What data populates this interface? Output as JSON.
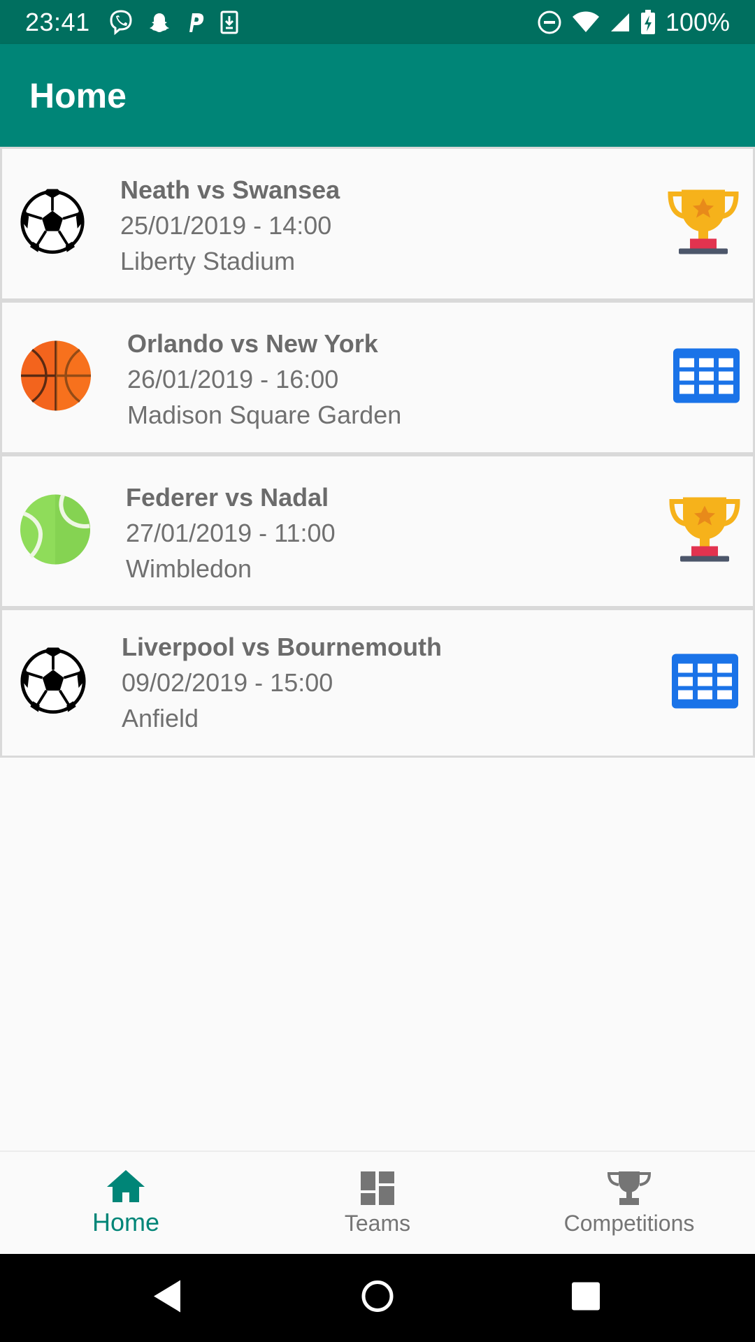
{
  "status_bar": {
    "time": "23:41",
    "battery_text": "100%",
    "left_icons": [
      "viber-icon",
      "snapchat-icon",
      "parking-icon",
      "download-icon"
    ],
    "right_icons": [
      "do-not-disturb-icon",
      "wifi-icon",
      "cell-signal-icon",
      "battery-charging-icon"
    ]
  },
  "app_bar": {
    "title": "Home"
  },
  "matches": [
    {
      "title": "Neath vs Swansea",
      "datetime": "25/01/2019 - 14:00",
      "venue": "Liberty Stadium",
      "sport_icon": "soccer-ball-icon",
      "action_icon": "trophy-icon"
    },
    {
      "title": "Orlando vs New York",
      "datetime": "26/01/2019 - 16:00",
      "venue": "Madison Square Garden",
      "sport_icon": "basketball-icon",
      "action_icon": "table-grid-icon"
    },
    {
      "title": "Federer vs Nadal",
      "datetime": "27/01/2019 - 11:00",
      "venue": "Wimbledon",
      "sport_icon": "tennis-ball-icon",
      "action_icon": "trophy-icon"
    },
    {
      "title": "Liverpool vs Bournemouth",
      "datetime": "09/02/2019 - 15:00",
      "venue": "Anfield",
      "sport_icon": "soccer-ball-icon",
      "action_icon": "table-grid-icon"
    }
  ],
  "bottom_nav": {
    "items": [
      {
        "label": "Home",
        "icon": "home-icon",
        "active": true
      },
      {
        "label": "Teams",
        "icon": "dashboard-icon",
        "active": false
      },
      {
        "label": "Competitions",
        "icon": "trophy-icon",
        "active": false
      }
    ]
  },
  "system_nav": {
    "icons": [
      "back-icon",
      "home-circle-icon",
      "recents-icon"
    ]
  },
  "colors": {
    "primary": "#008577",
    "primary_dark": "#006f5f",
    "nav_active": "#008577",
    "nav_inactive": "#757575",
    "grid_icon_blue": "#1a73e8",
    "trophy_gold": "#f6b21b"
  }
}
